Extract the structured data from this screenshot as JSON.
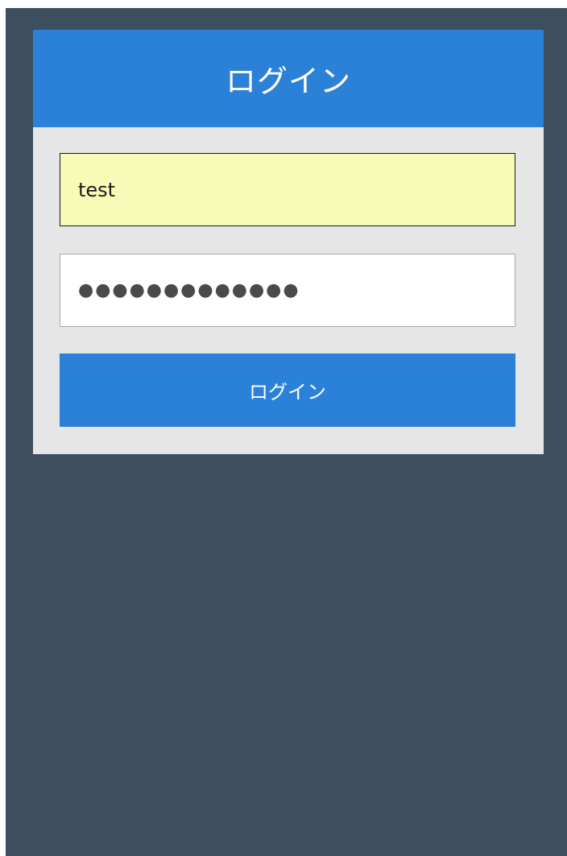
{
  "login": {
    "title": "ログイン",
    "username": {
      "value": "test"
    },
    "password": {
      "masked_value": "●●●●●●●●●●●●●"
    },
    "submit_label": "ログイン"
  },
  "colors": {
    "background": "#3d4e5e",
    "card": "#e6e6e6",
    "accent": "#2b80d8",
    "autofill": "#f8fbb8"
  }
}
